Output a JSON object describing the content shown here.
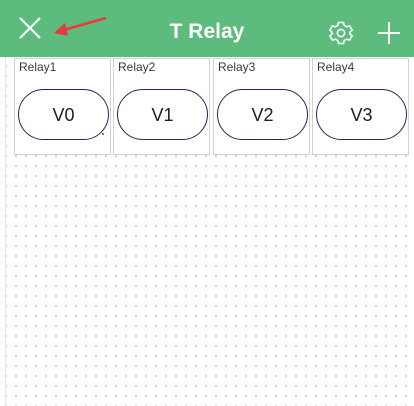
{
  "header": {
    "title": "T Relay",
    "close_icon": "close-icon",
    "settings_icon": "gear-icon",
    "add_icon": "plus-icon",
    "background_color": "#5dbb7e",
    "annotation": "red-arrow-pointing-to-close"
  },
  "widgets": [
    {
      "label": "Relay1",
      "button_text": "V0"
    },
    {
      "label": "Relay2",
      "button_text": "V1"
    },
    {
      "label": "Relay3",
      "button_text": "V2"
    },
    {
      "label": "Relay4",
      "button_text": "V3"
    }
  ],
  "colors": {
    "accent": "#5dbb7e",
    "button_border": "#1f2a5a",
    "arrow": "#e83a3a",
    "grid_dot": "#c7ccd0"
  }
}
